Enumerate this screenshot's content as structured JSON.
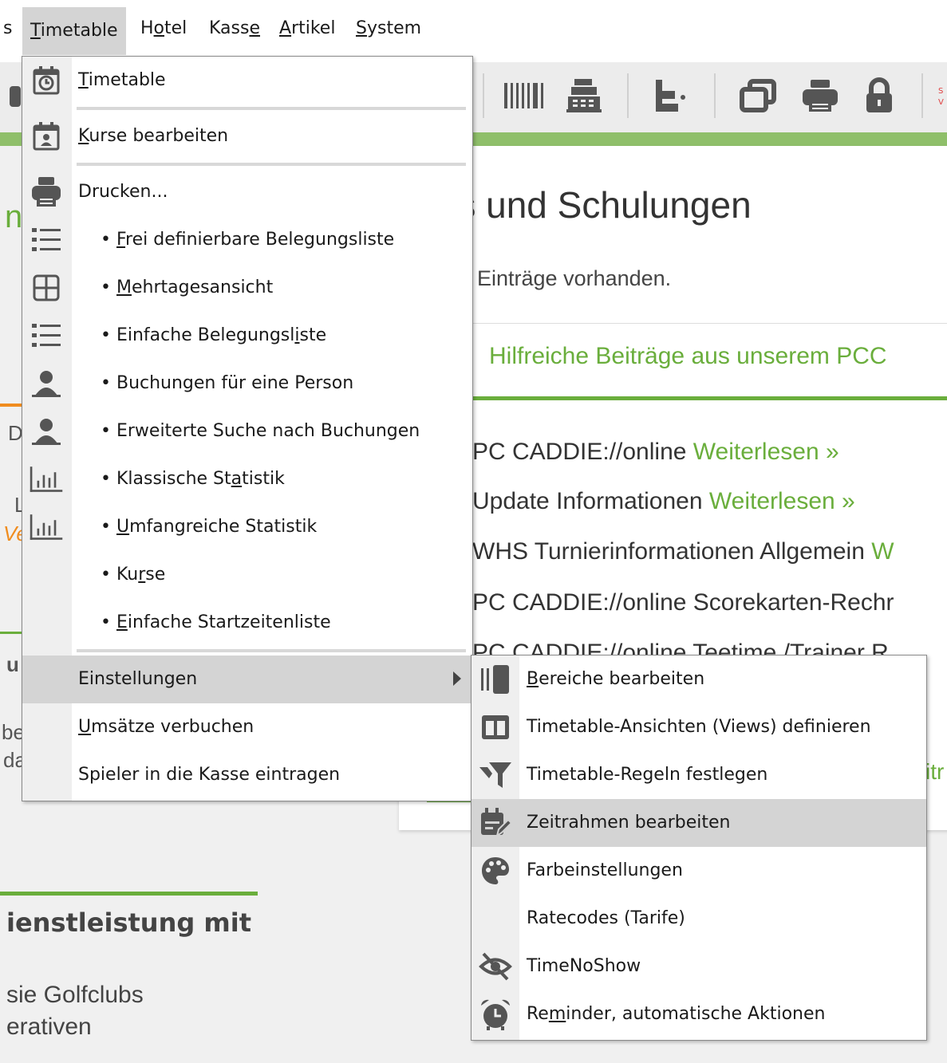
{
  "menubar": {
    "prefix": "s",
    "items": [
      {
        "pre": "",
        "u": "T",
        "post": "imetable"
      },
      {
        "pre": "H",
        "u": "o",
        "post": "tel"
      },
      {
        "pre": "Kass",
        "u": "e",
        "post": ""
      },
      {
        "pre": "",
        "u": "A",
        "post": "rtikel"
      },
      {
        "pre": "",
        "u": "S",
        "post": "ystem"
      }
    ]
  },
  "page": {
    "news_title": "nts und Schulungen",
    "news_sub": "Einträge vorhanden.",
    "tab_help": "Hilfreiche Beiträge aus unserem PCC",
    "news_rows": [
      {
        "text": "PC CADDIE://online ",
        "more": "Weiterlesen »"
      },
      {
        "text": "Update Informationen ",
        "more": "Weiterlesen »"
      },
      {
        "text": "WHS Turnierinformationen Allgemein ",
        "more": "W"
      },
      {
        "text": "PC CADDIE://online Scorekarten-Rechr",
        "more": ""
      },
      {
        "text": "PC CADDIE://online Teetime /Trainer R",
        "more": ""
      }
    ],
    "left_title": "ienstleistung mit",
    "left_text_1": "sie Golfclubs",
    "left_text_2": "erativen",
    "frag_itr": "itr",
    "frag_n": "n",
    "frag_d": "D",
    "frag_l": "L",
    "frag_ve": "Ve",
    "frag_u": "u",
    "frag_be": "be",
    "frag_da": "da"
  },
  "menu1": {
    "items": [
      {
        "pre": "",
        "u": "T",
        "post": "imetable",
        "icon": "timetable-clock-icon"
      },
      {
        "pre": "",
        "u": "K",
        "post": "urse bearbeiten",
        "icon": "course-calendar-icon"
      },
      {
        "pre": "Drucken...",
        "u": "",
        "post": "",
        "icon": "printer-icon"
      },
      {
        "pre": "• ",
        "u": "F",
        "post": "rei definierbare Belegungsliste",
        "icon": "list-icon"
      },
      {
        "pre": "• ",
        "u": "M",
        "post": "ehrtagesansicht",
        "icon": "grid-icon"
      },
      {
        "pre": "• Einfache Belegungsl",
        "u": "i",
        "post": "ste",
        "icon": "list-icon"
      },
      {
        "pre": "• Buchungen für eine Person",
        "u": "",
        "post": "",
        "icon": "person-icon"
      },
      {
        "pre": "• Erweiterte Suche nach Buchungen",
        "u": "",
        "post": "",
        "icon": "person-icon"
      },
      {
        "pre": "• Klassische St",
        "u": "a",
        "post": "tistik",
        "icon": "bar-chart-icon"
      },
      {
        "pre": "• ",
        "u": "U",
        "post": "mfangreiche Statistik",
        "icon": "bar-chart-icon"
      },
      {
        "pre": "• Ku",
        "u": "r",
        "post": "se",
        "icon": ""
      },
      {
        "pre": "• ",
        "u": "E",
        "post": "infache Startzeitenliste",
        "icon": ""
      },
      {
        "pre": "Einstellungen",
        "u": "",
        "post": "",
        "icon": ""
      },
      {
        "pre": "",
        "u": "U",
        "post": "msätze verbuchen",
        "icon": ""
      },
      {
        "pre": "Spieler in die Kasse eintragen",
        "u": "",
        "post": "",
        "icon": ""
      }
    ]
  },
  "menu2": {
    "items": [
      {
        "pre": "",
        "u": "B",
        "post": "ereiche bearbeiten",
        "icon": "areas-icon"
      },
      {
        "pre": "Timetable-Ansichten (Views) definieren",
        "u": "",
        "post": "",
        "icon": "columns-icon"
      },
      {
        "pre": "Timetable-Regeln festlegen",
        "u": "",
        "post": "",
        "icon": "filter-rules-icon"
      },
      {
        "pre": "Zeitrahmen bearbeiten",
        "u": "",
        "post": "",
        "icon": "calendar-edit-icon"
      },
      {
        "pre": "Farbeinstellungen",
        "u": "",
        "post": "",
        "icon": "palette-icon"
      },
      {
        "pre": "Ratecodes (Tarife)",
        "u": "",
        "post": "",
        "icon": ""
      },
      {
        "pre": "TimeNoShow",
        "u": "",
        "post": "",
        "icon": "eye-slash-icon"
      },
      {
        "pre": "Re",
        "u": "m",
        "post": "inder, automatische Aktionen",
        "icon": "alarm-clock-icon"
      }
    ]
  },
  "colors": {
    "accent_green": "#6aae3c",
    "highlight": "#d4d4d4",
    "icon_gray": "#555555"
  }
}
